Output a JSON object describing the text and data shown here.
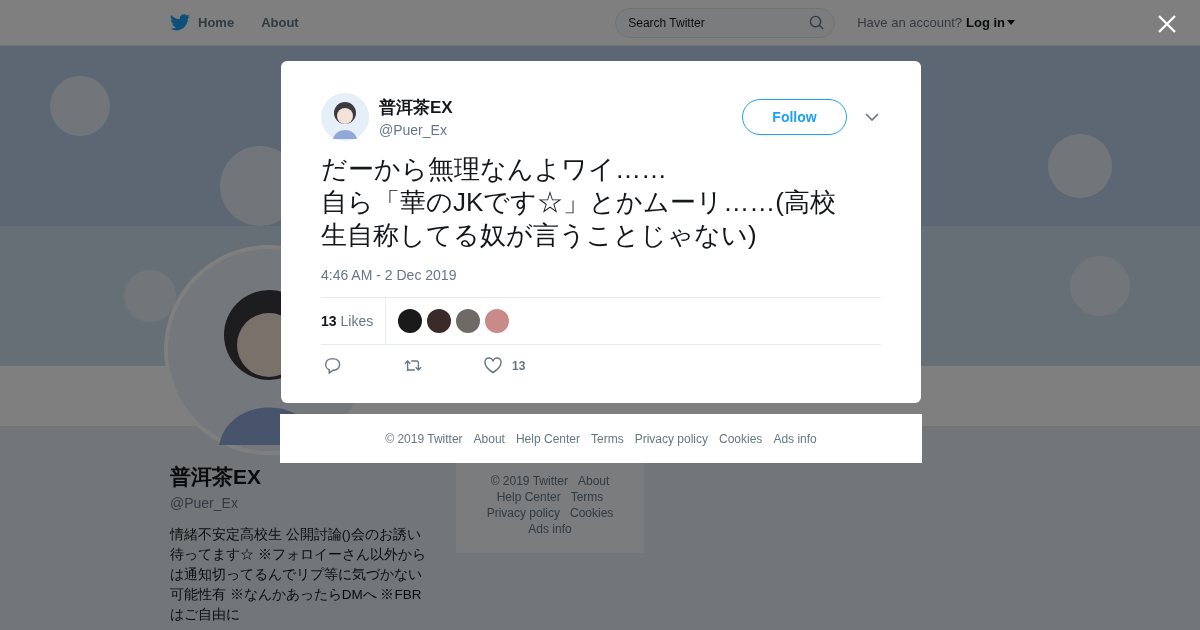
{
  "nav": {
    "items": [
      {
        "label": "Home"
      },
      {
        "label": "About"
      }
    ],
    "search": {
      "placeholder": "Search Twitter"
    },
    "account_prompt": "Have an account?",
    "login": "Log in"
  },
  "profile": {
    "name": "普洱茶EX",
    "handle": "@Puer_Ex",
    "bio": "情緒不安定高校生 公開討論()会のお誘い待ってます☆ ※フォロイーさん以外からは通知切ってるんでリプ等に気づかない可能性有 ※なんかあったらDMへ ※FBRはご自由に"
  },
  "side_footer": {
    "links": [
      "© 2019 Twitter",
      "About",
      "Help Center",
      "Terms",
      "Privacy policy",
      "Cookies",
      "Ads info"
    ]
  },
  "modal": {
    "author": {
      "name": "普洱茶EX",
      "handle": "@Puer_Ex"
    },
    "follow": "Follow",
    "text": "だーから無理なんよワイ……\n自ら「華のJKです☆」とかムーリ……(高校生自称してる奴が言うことじゃない)",
    "time": "4:46 AM - 2 Dec 2019",
    "likes": {
      "count": "13",
      "label": "Likes"
    },
    "likers": [
      {
        "color": "#1a1a1a"
      },
      {
        "color": "#3a2a2a"
      },
      {
        "color": "#6e6a66"
      },
      {
        "color": "#c98a8a"
      }
    ],
    "like_count": "13"
  },
  "footer": {
    "links": [
      "© 2019 Twitter",
      "About",
      "Help Center",
      "Terms",
      "Privacy policy",
      "Cookies",
      "Ads info"
    ]
  }
}
